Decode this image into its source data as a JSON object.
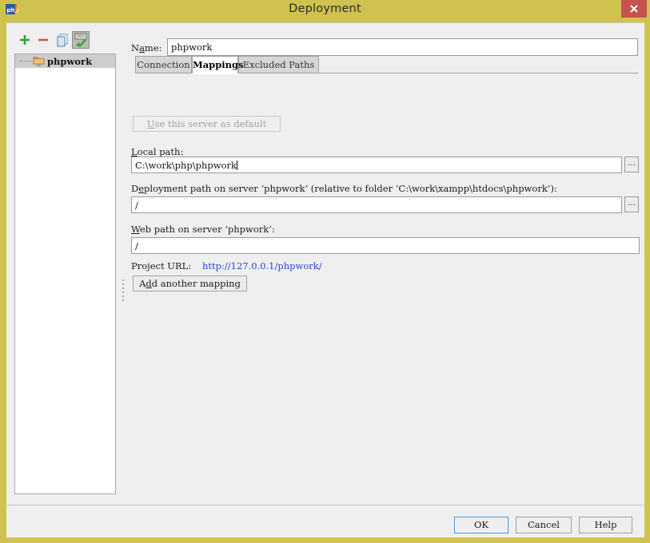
{
  "window": {
    "title": "Deployment",
    "app_icon": "phpstorm-logo-icon",
    "close_label": "✕",
    "titlebar_color": "#cfc24f",
    "close_color": "#c5524f"
  },
  "sidebar": {
    "toolbar": [
      {
        "name": "add-server-button",
        "glyph": "+",
        "color": "#3a9b3a",
        "pressed": false
      },
      {
        "name": "remove-server-button",
        "glyph": "−",
        "color": "#cc5a50",
        "pressed": false
      },
      {
        "name": "copy-server-button",
        "glyph": "copy-icon",
        "color": "#5b8fc9",
        "pressed": false
      },
      {
        "name": "use-as-default-toggle-button",
        "glyph": "server-check-icon",
        "color": "#3a9b3a",
        "pressed": true
      }
    ],
    "tree": {
      "items": [
        {
          "label": "phpwork",
          "icon": "server-folder-icon",
          "selected": true
        }
      ]
    }
  },
  "form": {
    "name_label": "Name:",
    "name_label_mnemonic_index": 2,
    "name_value": "phpwork",
    "tabs": [
      {
        "label": "Connection",
        "active": false
      },
      {
        "label": "Mappings",
        "active": true
      },
      {
        "label": "Excluded Paths",
        "active": false
      }
    ],
    "use_default_button": {
      "label": "Use this server as default",
      "mnemonic_index": 0,
      "disabled": true
    },
    "local_path": {
      "label": "Local path:",
      "mnemonic_index": 0,
      "value": "C:\\work\\php\\phpwork",
      "has_caret": true,
      "browse_label": "..."
    },
    "deployment_path": {
      "label": "Deployment path on server ‘phpwork’ (relative to folder ‘C:\\work\\xampp\\htdocs\\phpwork’):",
      "mnemonic_index": 1,
      "value": "/",
      "browse_label": "..."
    },
    "web_path": {
      "label": "Web path on server ‘phpwork’:",
      "mnemonic_index": 0,
      "value": "/"
    },
    "project_url": {
      "label": "Project URL:",
      "value": "http://127.0.0.1/phpwork/",
      "color": "#2b42d8"
    },
    "add_mapping_button": {
      "label": "Add another mapping",
      "mnemonic_index": 2
    }
  },
  "footer": {
    "buttons": [
      {
        "name": "ok-button",
        "label": "OK",
        "default": true
      },
      {
        "name": "cancel-button",
        "label": "Cancel",
        "default": false
      },
      {
        "name": "help-button",
        "label": "Help",
        "default": false
      }
    ]
  }
}
